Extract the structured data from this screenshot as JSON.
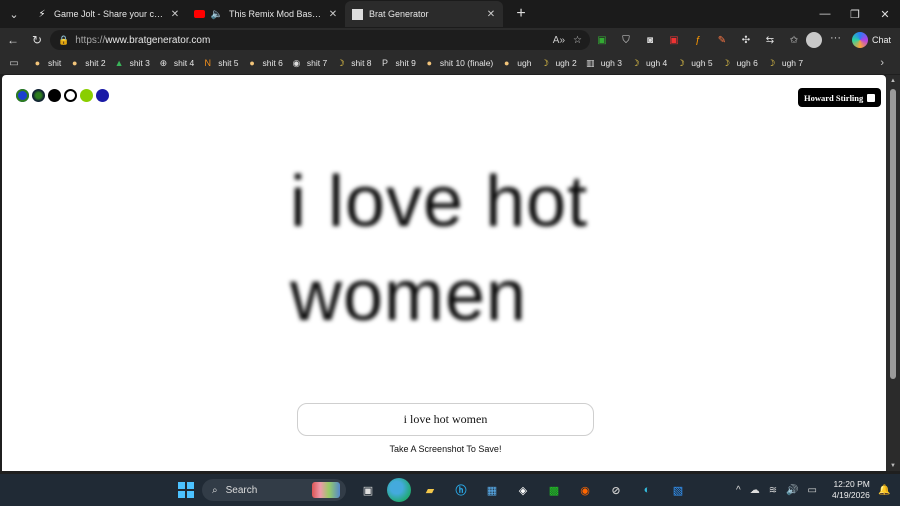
{
  "tabs": [
    {
      "title": "Game Jolt - Share your creations",
      "icon": "game-jolt-icon",
      "active": false
    },
    {
      "title": "This Remix Mod Based on Scr",
      "icon": "youtube-icon",
      "active": false
    },
    {
      "title": "Brat Generator",
      "icon": "brat-icon",
      "active": true
    }
  ],
  "address": {
    "scheme": "https://",
    "host": "www.bratgenerator.com"
  },
  "bookmarks": [
    {
      "label": "shit",
      "icon": "bread-icon"
    },
    {
      "label": "shit 2",
      "icon": "bread-icon"
    },
    {
      "label": "shit 3",
      "icon": "drive-icon"
    },
    {
      "label": "shit 4",
      "icon": "globe-icon"
    },
    {
      "label": "shit 5",
      "icon": "ng-icon"
    },
    {
      "label": "shit 6",
      "icon": "bread-icon"
    },
    {
      "label": "shit 7",
      "icon": "github-icon"
    },
    {
      "label": "shit 8",
      "icon": "banana-icon"
    },
    {
      "label": "shit 9",
      "icon": "p-icon"
    },
    {
      "label": "shit 10 (finale)",
      "icon": "bread-icon"
    },
    {
      "label": "ugh",
      "icon": "bread-icon"
    },
    {
      "label": "ugh 2",
      "icon": "banana-icon"
    },
    {
      "label": "ugh 3",
      "icon": "building-icon"
    },
    {
      "label": "ugh 4",
      "icon": "banana-icon"
    },
    {
      "label": "ugh 5",
      "icon": "banana-icon"
    },
    {
      "label": "ugh 6",
      "icon": "banana-icon"
    },
    {
      "label": "ugh 7",
      "icon": "banana-icon"
    }
  ],
  "page": {
    "swatches": [
      "#1a3fd0",
      "#2e7d1e",
      "#000000",
      "#ffffff",
      "#8ace00",
      "#1a1aa6"
    ],
    "author_badge": "Howard Stirling",
    "display_line1": "i love hot",
    "display_line2": "women",
    "input_value": "i love hot women",
    "hint": "Take A Screenshot To Save!"
  },
  "browser": {
    "chat_label": "Chat"
  },
  "taskbar": {
    "search_label": "Search",
    "time": "12:20 PM",
    "date": "4/19/2026"
  }
}
